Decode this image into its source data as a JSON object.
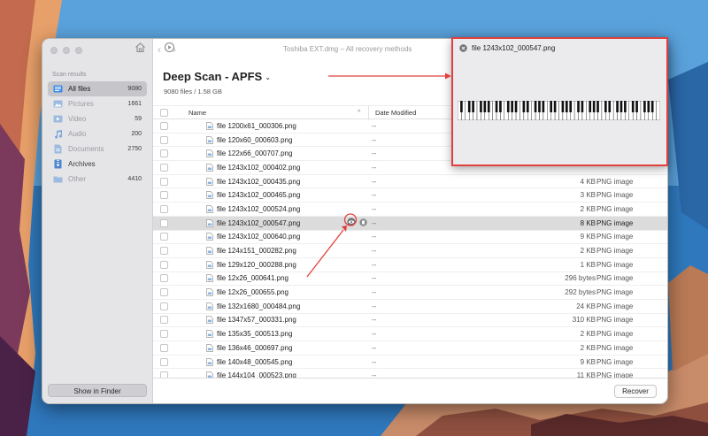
{
  "window": {
    "title": "Toshiba EXT.dmg – All recovery methods",
    "back_icon": "chevron-left",
    "forward_icon": "chevron-right",
    "home_icon": "house",
    "restore_icon": "clock-restore"
  },
  "sidebar": {
    "section_title": "Scan results",
    "items": [
      {
        "label": "All files",
        "count": "9080",
        "icon": "all-files",
        "active": true
      },
      {
        "label": "Pictures",
        "count": "1661",
        "icon": "pictures"
      },
      {
        "label": "Video",
        "count": "59",
        "icon": "video"
      },
      {
        "label": "Audio",
        "count": "200",
        "icon": "audio"
      },
      {
        "label": "Documents",
        "count": "2750",
        "icon": "documents"
      },
      {
        "label": "Archives",
        "count": "",
        "icon": "archives"
      },
      {
        "label": "Other",
        "count": "4410",
        "icon": "other"
      }
    ],
    "finder_button": "Show in Finder"
  },
  "main": {
    "title": "Deep Scan - APFS",
    "summary": "9080 files / 1.58 GB",
    "columns": {
      "name": "Name",
      "date": "Date Modified"
    },
    "rows": [
      {
        "name": "file 1200x61_000306.png",
        "date": "--",
        "size": "",
        "type": ""
      },
      {
        "name": "file 120x60_000603.png",
        "date": "--",
        "size": "",
        "type": ""
      },
      {
        "name": "file 122x66_000707.png",
        "date": "--",
        "size": "",
        "type": ""
      },
      {
        "name": "file 1243x102_000402.png",
        "date": "--",
        "size": "",
        "type": ""
      },
      {
        "name": "file 1243x102_000435.png",
        "date": "--",
        "size": "4 KB",
        "type": "PNG image"
      },
      {
        "name": "file 1243x102_000465.png",
        "date": "--",
        "size": "3 KB",
        "type": "PNG image"
      },
      {
        "name": "file 1243x102_000524.png",
        "date": "--",
        "size": "2 KB",
        "type": "PNG image"
      },
      {
        "name": "file 1243x102_000547.png",
        "date": "--",
        "size": "8 KB",
        "type": "PNG image",
        "selected": true
      },
      {
        "name": "file 1243x102_000640.png",
        "date": "--",
        "size": "9 KB",
        "type": "PNG image"
      },
      {
        "name": "file 124x151_000282.png",
        "date": "--",
        "size": "2 KB",
        "type": "PNG image"
      },
      {
        "name": "file 129x120_000288.png",
        "date": "--",
        "size": "1 KB",
        "type": "PNG image"
      },
      {
        "name": "file 12x26_000641.png",
        "date": "--",
        "size": "296 bytes",
        "type": "PNG image"
      },
      {
        "name": "file 12x26_000655.png",
        "date": "--",
        "size": "292 bytes",
        "type": "PNG image"
      },
      {
        "name": "file 132x1680_000484.png",
        "date": "--",
        "size": "24 KB",
        "type": "PNG image"
      },
      {
        "name": "file 1347x57_000331.png",
        "date": "--",
        "size": "310 KB",
        "type": "PNG image"
      },
      {
        "name": "file 135x35_000513.png",
        "date": "--",
        "size": "2 KB",
        "type": "PNG image"
      },
      {
        "name": "file 136x46_000697.png",
        "date": "--",
        "size": "2 KB",
        "type": "PNG image"
      },
      {
        "name": "file 140x48_000545.png",
        "date": "--",
        "size": "9 KB",
        "type": "PNG image"
      },
      {
        "name": "file 144x104_000523.png",
        "date": "--",
        "size": "11 KB",
        "type": "PNG image"
      }
    ],
    "recover_button": "Recover"
  },
  "preview": {
    "title": "file 1243x102_000547.png",
    "close_icon": "close-circle"
  },
  "colors": {
    "annotation": "#e0403d",
    "selected_row": "#dcdcdc",
    "sidebar_active": "#c5c5ca"
  }
}
